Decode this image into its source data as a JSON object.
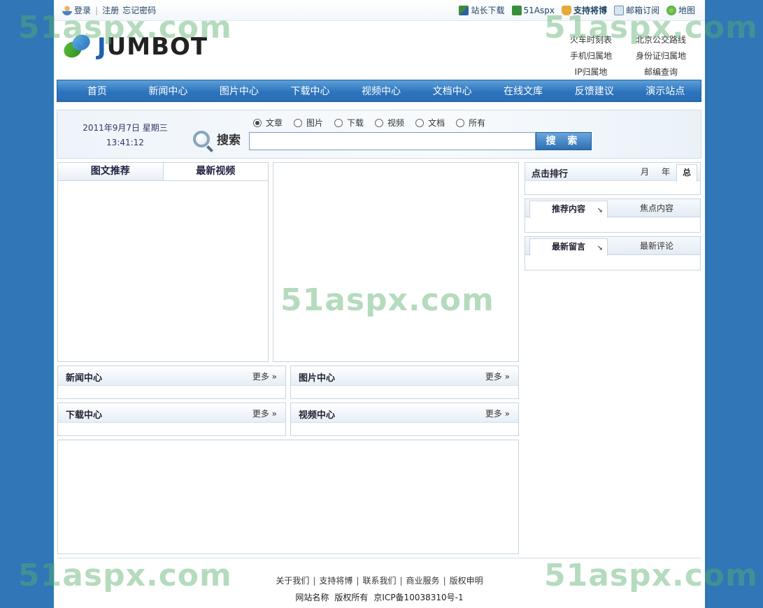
{
  "watermark": "51aspx.com",
  "topbar": {
    "login": "登录",
    "register": "注册",
    "forgot": "忘记密码",
    "right": [
      {
        "label": "站长下载",
        "icon": "download-icon"
      },
      {
        "label": "51Aspx",
        "icon": "51aspx-icon"
      },
      {
        "label": "支持将博",
        "icon": "thumbs-up-icon"
      },
      {
        "label": "邮箱订阅",
        "icon": "mail-icon"
      },
      {
        "label": "地图",
        "icon": "globe-icon"
      }
    ]
  },
  "logo": {
    "j": "J",
    "rest": "UMBOT"
  },
  "header_links": [
    "火车时刻表",
    "北京公交路线",
    "手机归属地",
    "身份证归属地",
    "IP归属地",
    "邮编查询"
  ],
  "nav": [
    "首页",
    "新闻中心",
    "图片中心",
    "下载中心",
    "视频中心",
    "文档中心",
    "在线文库",
    "反馈建议",
    "演示站点"
  ],
  "search": {
    "date": "2011年9月7日 星期三",
    "time": "13:41:12",
    "label": "搜索",
    "options": [
      "文章",
      "图片",
      "下载",
      "视频",
      "文档",
      "所有"
    ],
    "selected": "文章",
    "value": "",
    "button": "搜 索"
  },
  "left_tabs": [
    "图文推荐",
    "最新视频"
  ],
  "rank": {
    "title": "点击排行",
    "tabs": [
      "月",
      "年",
      "总"
    ],
    "active": "总"
  },
  "recommend": {
    "active": "推荐内容",
    "other": "焦点内容",
    "arrow": "↘"
  },
  "messages": {
    "active": "最新留言",
    "other": "最新评论",
    "arrow": "↘"
  },
  "sections": [
    {
      "title": "新闻中心",
      "more": "更多 »"
    },
    {
      "title": "图片中心",
      "more": "更多 »"
    },
    {
      "title": "下载中心",
      "more": "更多 »"
    },
    {
      "title": "视频中心",
      "more": "更多 »"
    }
  ],
  "footer": {
    "links": [
      "关于我们",
      "支持将博",
      "联系我们",
      "商业服务",
      "版权申明"
    ],
    "site_name": "网站名称",
    "rights": "版权所有",
    "icp": "京ICP备10038310号-1"
  }
}
